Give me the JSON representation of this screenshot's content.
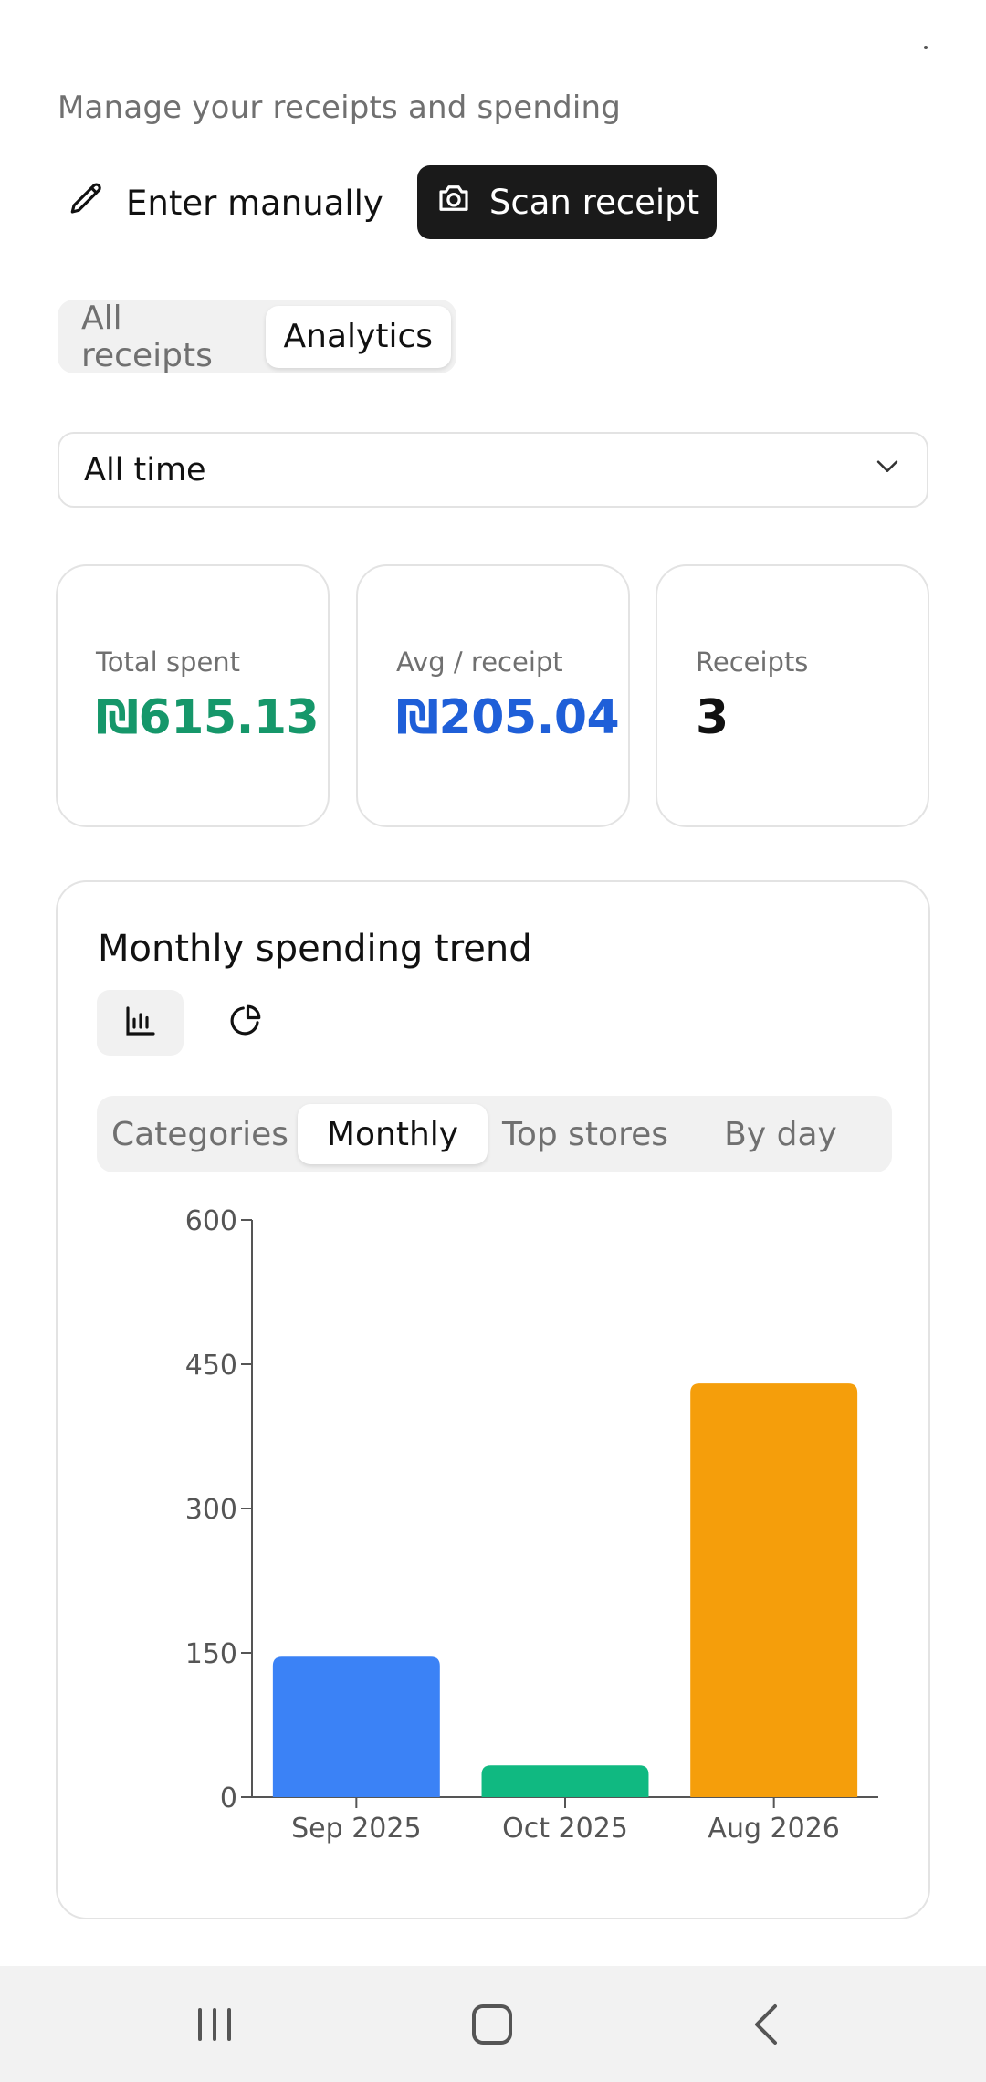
{
  "header": {
    "subtitle": "Manage your receipts and spending"
  },
  "actions": {
    "manual_label": "Enter manually",
    "scan_label": "Scan receipt"
  },
  "view_tabs": [
    {
      "label": "All receipts",
      "active": false
    },
    {
      "label": "Analytics",
      "active": true
    }
  ],
  "filter": {
    "selected": "All time"
  },
  "stats": [
    {
      "label": "Total spent",
      "value": "₪615.13",
      "color": "#16976a"
    },
    {
      "label": "Avg / receipt",
      "value": "₪205.04",
      "color": "#1f5fd8"
    },
    {
      "label": "Receipts",
      "value": "3",
      "color": "#111111"
    }
  ],
  "trend": {
    "title": "Monthly spending trend",
    "chart_views": [
      {
        "icon": "bar-chart-icon",
        "active": true
      },
      {
        "icon": "pie-chart-icon",
        "active": false
      }
    ],
    "tabs": [
      {
        "label": "Categories",
        "active": false
      },
      {
        "label": "Monthly",
        "active": true
      },
      {
        "label": "Top stores",
        "active": false
      },
      {
        "label": "By day",
        "active": false
      }
    ]
  },
  "chart_data": {
    "type": "bar",
    "title": "Monthly spending trend",
    "categories": [
      "Sep 2025",
      "Oct 2025",
      "Aug 2026"
    ],
    "values": [
      146,
      33,
      430
    ],
    "colors": [
      "#3b82f6",
      "#10b981",
      "#f59e0b"
    ],
    "ylim": [
      0,
      600
    ],
    "yticks": [
      0,
      150,
      300,
      450,
      600
    ],
    "xlabel": "",
    "ylabel": "",
    "grid": false
  },
  "navbar": {
    "icons": [
      "recent-apps-icon",
      "home-icon",
      "back-icon"
    ]
  }
}
